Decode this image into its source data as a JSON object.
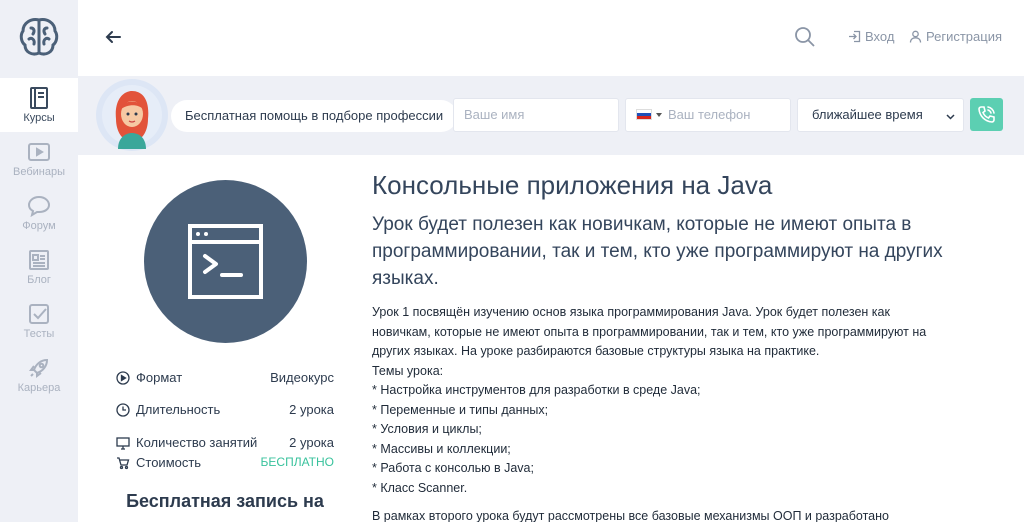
{
  "sidebar": {
    "items": [
      {
        "label": "Курсы",
        "icon": "book-icon",
        "active": true
      },
      {
        "label": "Вебинары",
        "icon": "video-icon"
      },
      {
        "label": "Форум",
        "icon": "chat-icon"
      },
      {
        "label": "Блог",
        "icon": "blog-icon"
      },
      {
        "label": "Тесты",
        "icon": "checkbox-icon"
      },
      {
        "label": "Карьера",
        "icon": "rocket-icon"
      }
    ]
  },
  "header": {
    "login": "Вход",
    "register": "Регистрация"
  },
  "promo": {
    "text": "Бесплатная помощь в подборе профессии",
    "name_placeholder": "Ваше имя",
    "phone_placeholder": "Ваш телефон",
    "time_select": "ближайшее время"
  },
  "course": {
    "title": "Консольные приложения на Java",
    "subtitle": "Урок будет полезен как новичкам, которые не имеют опыта в программировании, так и тем, кто уже программируют на других языках.",
    "info": [
      {
        "key": "Формат",
        "value": "Видеокурс",
        "icon": "play-circle-icon"
      },
      {
        "key": "Длительность",
        "value": "2 урока",
        "icon": "clock-icon"
      },
      {
        "key": "Количество занятий",
        "value": "2 урока",
        "icon": "monitor-icon"
      },
      {
        "key": "Стоимость",
        "value": "БЕСПЛАТНО",
        "icon": "cart-icon"
      }
    ],
    "signup_title": "Бесплатная запись на курс",
    "description": [
      "Урок 1 посвящён изучению основ языка программирования Java. Урок будет полезен как новичкам, которые не имеют опыта в программировании, так и тем, кто уже программируют на других языках. На уроке разбираются базовые структуры языка на практике.",
      "Темы урока:",
      "* Настройка инструментов для разработки в среде Java;",
      "* Переменные и типы данных;",
      "* Условия и циклы;",
      "* Массивы и коллекции;",
      "* Работа с консолью в Java;",
      "* Класс Scanner."
    ],
    "description_more": "В рамках второго урока будут рассмотрены все базовые механизмы ООП и разработано"
  },
  "colors": {
    "accent": "#5ccfb2",
    "sidebar_bg": "#eef0f6",
    "course_icon_bg": "#4b6078",
    "free_text": "#38c29c"
  }
}
